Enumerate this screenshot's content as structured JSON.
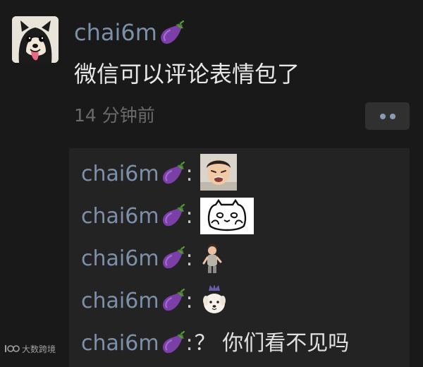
{
  "post": {
    "username": "chai6m",
    "username_emoji": "eggplant-icon",
    "text": "微信可以评论表情包了",
    "time": "14 分钟前"
  },
  "comments": [
    {
      "username": "chai6m",
      "colon": ":",
      "sticker": "crying-kid-sticker",
      "text": ""
    },
    {
      "username": "chai6m",
      "colon": ":",
      "sticker": "hiding-cat-sticker",
      "text": ""
    },
    {
      "username": "chai6m",
      "colon": ":",
      "sticker": "small-kid-sticker",
      "text": ""
    },
    {
      "username": "chai6m",
      "colon": ":",
      "sticker": "crowned-dog-sticker",
      "text": ""
    },
    {
      "username": "chai6m",
      "colon": ":",
      "sticker": "",
      "text": "？ 你们看不见吗"
    }
  ],
  "watermark": {
    "logo_text": "100",
    "text": "大数跨境"
  },
  "colors": {
    "background": "#191919",
    "comment_panel": "#232323",
    "username": "#7d90a9",
    "time": "#6a6a6a"
  }
}
